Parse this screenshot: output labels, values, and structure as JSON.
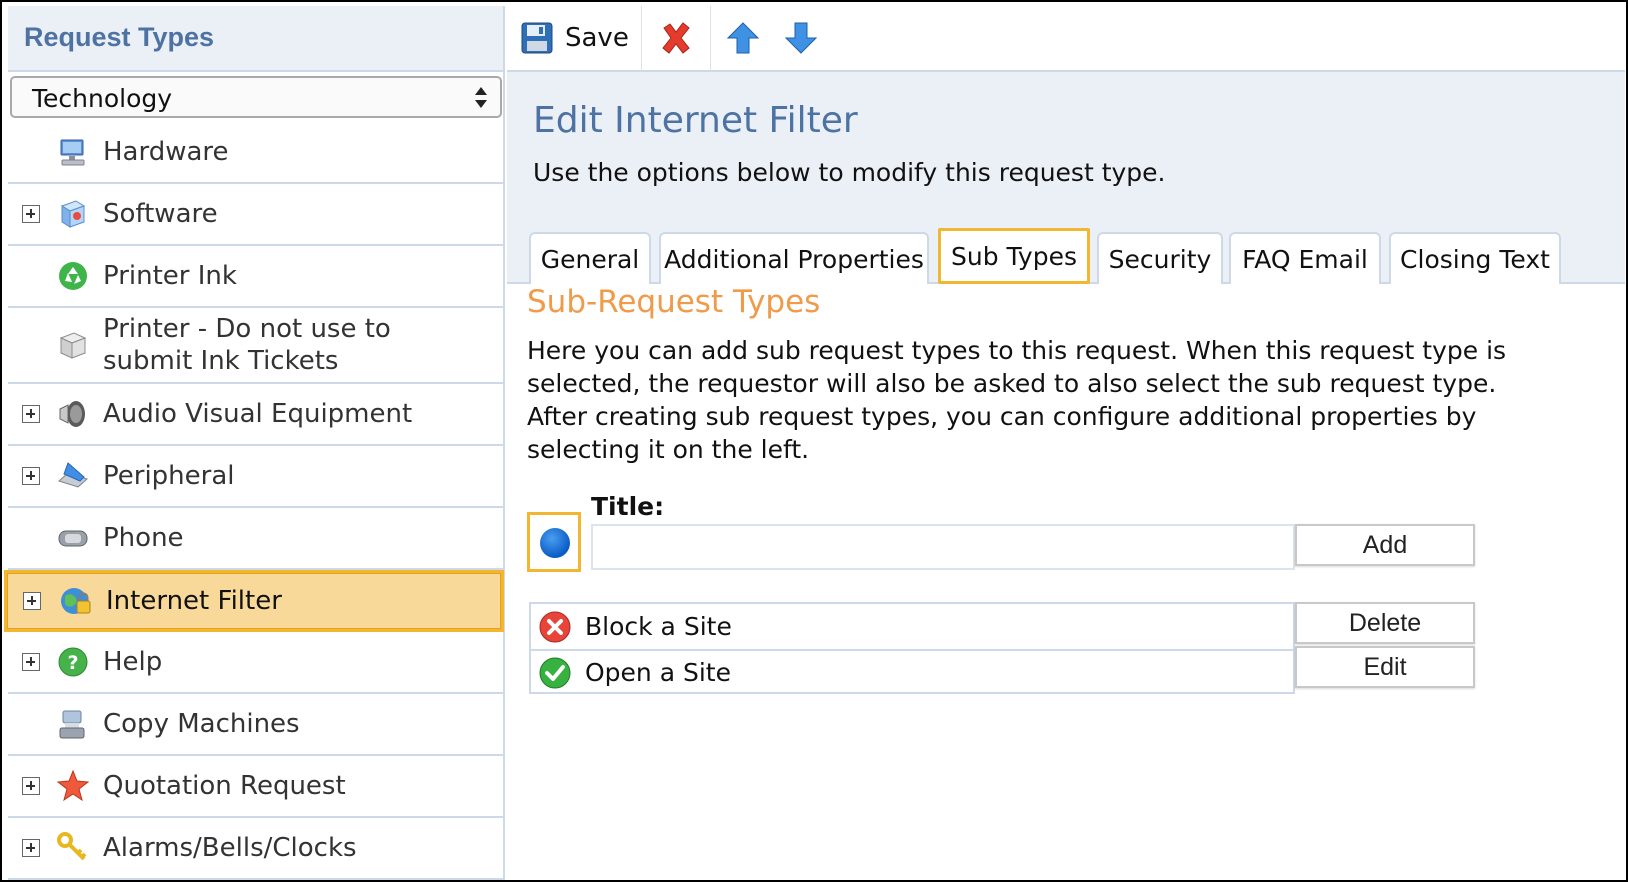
{
  "sidebar": {
    "header": "Request Types",
    "category": "Technology",
    "items": [
      {
        "label": "Hardware",
        "expandable": false,
        "icon": "computer-icon"
      },
      {
        "label": "Software",
        "expandable": true,
        "icon": "software-box-icon"
      },
      {
        "label": "Printer Ink",
        "expandable": false,
        "icon": "recycle-icon"
      },
      {
        "label": "Printer - Do not use to submit Ink Tickets",
        "expandable": false,
        "icon": "package-icon"
      },
      {
        "label": "Audio Visual Equipment",
        "expandable": true,
        "icon": "speaker-icon"
      },
      {
        "label": "Peripheral",
        "expandable": true,
        "icon": "scanner-icon"
      },
      {
        "label": "Phone",
        "expandable": false,
        "icon": "phone-icon"
      },
      {
        "label": "Internet Filter",
        "expandable": true,
        "icon": "globe-lock-icon",
        "selected": true
      },
      {
        "label": "Help",
        "expandable": true,
        "icon": "help-icon"
      },
      {
        "label": "Copy Machines",
        "expandable": false,
        "icon": "copier-icon"
      },
      {
        "label": "Quotation Request",
        "expandable": true,
        "icon": "star-icon"
      },
      {
        "label": "Alarms/Bells/Clocks",
        "expandable": true,
        "icon": "keys-icon"
      }
    ]
  },
  "toolbar": {
    "save_label": "Save"
  },
  "header": {
    "title": "Edit Internet Filter",
    "subtitle": "Use the options below to modify this request type."
  },
  "tabs": [
    {
      "label": "General"
    },
    {
      "label": "Additional Properties"
    },
    {
      "label": "Sub Types",
      "active": true
    },
    {
      "label": "Security"
    },
    {
      "label": "FAQ Email"
    },
    {
      "label": "Closing Text"
    }
  ],
  "content": {
    "section_title": "Sub-Request Types",
    "description": "Here you can add sub request types to this request. When this request type is selected, the requestor will also be asked to also select the sub request type. After creating sub request types, you can configure additional properties by selecting it on the left.",
    "title_label": "Title:",
    "title_value": "",
    "add_label": "Add",
    "delete_label": "Delete",
    "edit_label": "Edit",
    "subtypes": [
      {
        "label": "Block a Site",
        "icon": "block-icon"
      },
      {
        "label": "Open a Site",
        "icon": "check-icon"
      }
    ]
  },
  "colors": {
    "accent_blue": "#4d72a3",
    "section_orange": "#f09b4a",
    "highlight": "#f2b630",
    "panel_bg": "#ebf0f6"
  }
}
